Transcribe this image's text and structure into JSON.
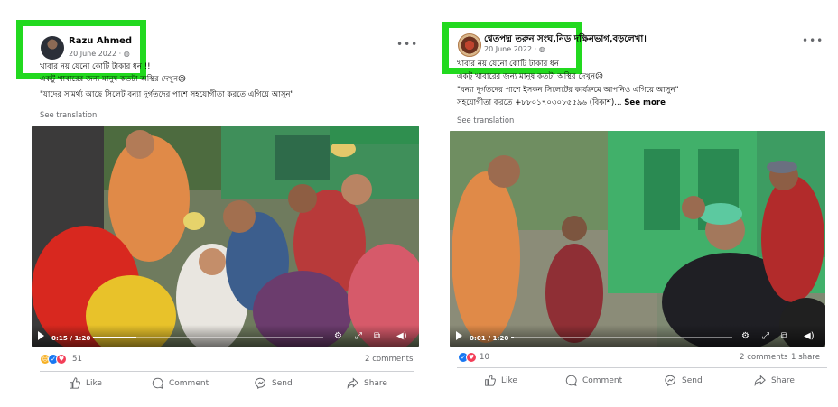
{
  "posts": [
    {
      "author": "Razu Ahmed",
      "date": "20 June 2022",
      "audience_icon": "globe-icon",
      "text_lines": [
        "খাবার নয় যেনো কোটি টাকার ধন !!",
        "একটু খাবারের জন্য মানুষ কতটা অস্থির দেখুন😥",
        "\"যাদের সামর্থ্য আছে সিলেট বন্যা দুর্গতদের পাশে সহযোগীতা করতে এগিয়ে আসুন\""
      ],
      "see_translation": "See translation",
      "video": {
        "time": "0:15 / 1:20",
        "progress": 0.1875
      },
      "reactions": {
        "icons": [
          "sad-reaction-icon",
          "like-reaction-icon",
          "love-reaction-icon"
        ],
        "count": "51"
      },
      "comments": "2 comments",
      "shares": "",
      "actions": {
        "like": "Like",
        "comment": "Comment",
        "send": "Send",
        "share": "Share"
      }
    },
    {
      "author": "শ্বেতপদ্ম তরুন সংঘ,নিড দক্ষিনভাগ,বড়লেখা।",
      "date": "20 June 2022",
      "audience_icon": "globe-icon",
      "text_lines": [
        "খাবার নয় যেনো কোটি টাকার ধন",
        "একটু খাবারের জন্য মানুষ কতটা অস্থির দেখুন😥",
        "\"বন্যা দুর্গতদের পাশে ইসকন সিলেটের কার্যক্রমে আপনিও এগিয়ে আসুন\"",
        "সহযোগীতা করতে +৮৮০১৭০৩০৮৫৫৯৬ (বিকাশ)... "
      ],
      "see_more": "See more",
      "see_translation": "See translation",
      "video": {
        "time": "0:01 / 1:20",
        "progress": 0.0125
      },
      "reactions": {
        "icons": [
          "like-reaction-icon",
          "love-reaction-icon"
        ],
        "count": "10"
      },
      "comments": "2 comments",
      "shares": "1 share",
      "actions": {
        "like": "Like",
        "comment": "Comment",
        "send": "Send",
        "share": "Share"
      }
    }
  ],
  "colors": {
    "highlight": "#22d91f",
    "like_blue": "#1877f2",
    "love_red": "#f33e58",
    "sad_yellow": "#f7b125",
    "muted": "#65676b"
  }
}
